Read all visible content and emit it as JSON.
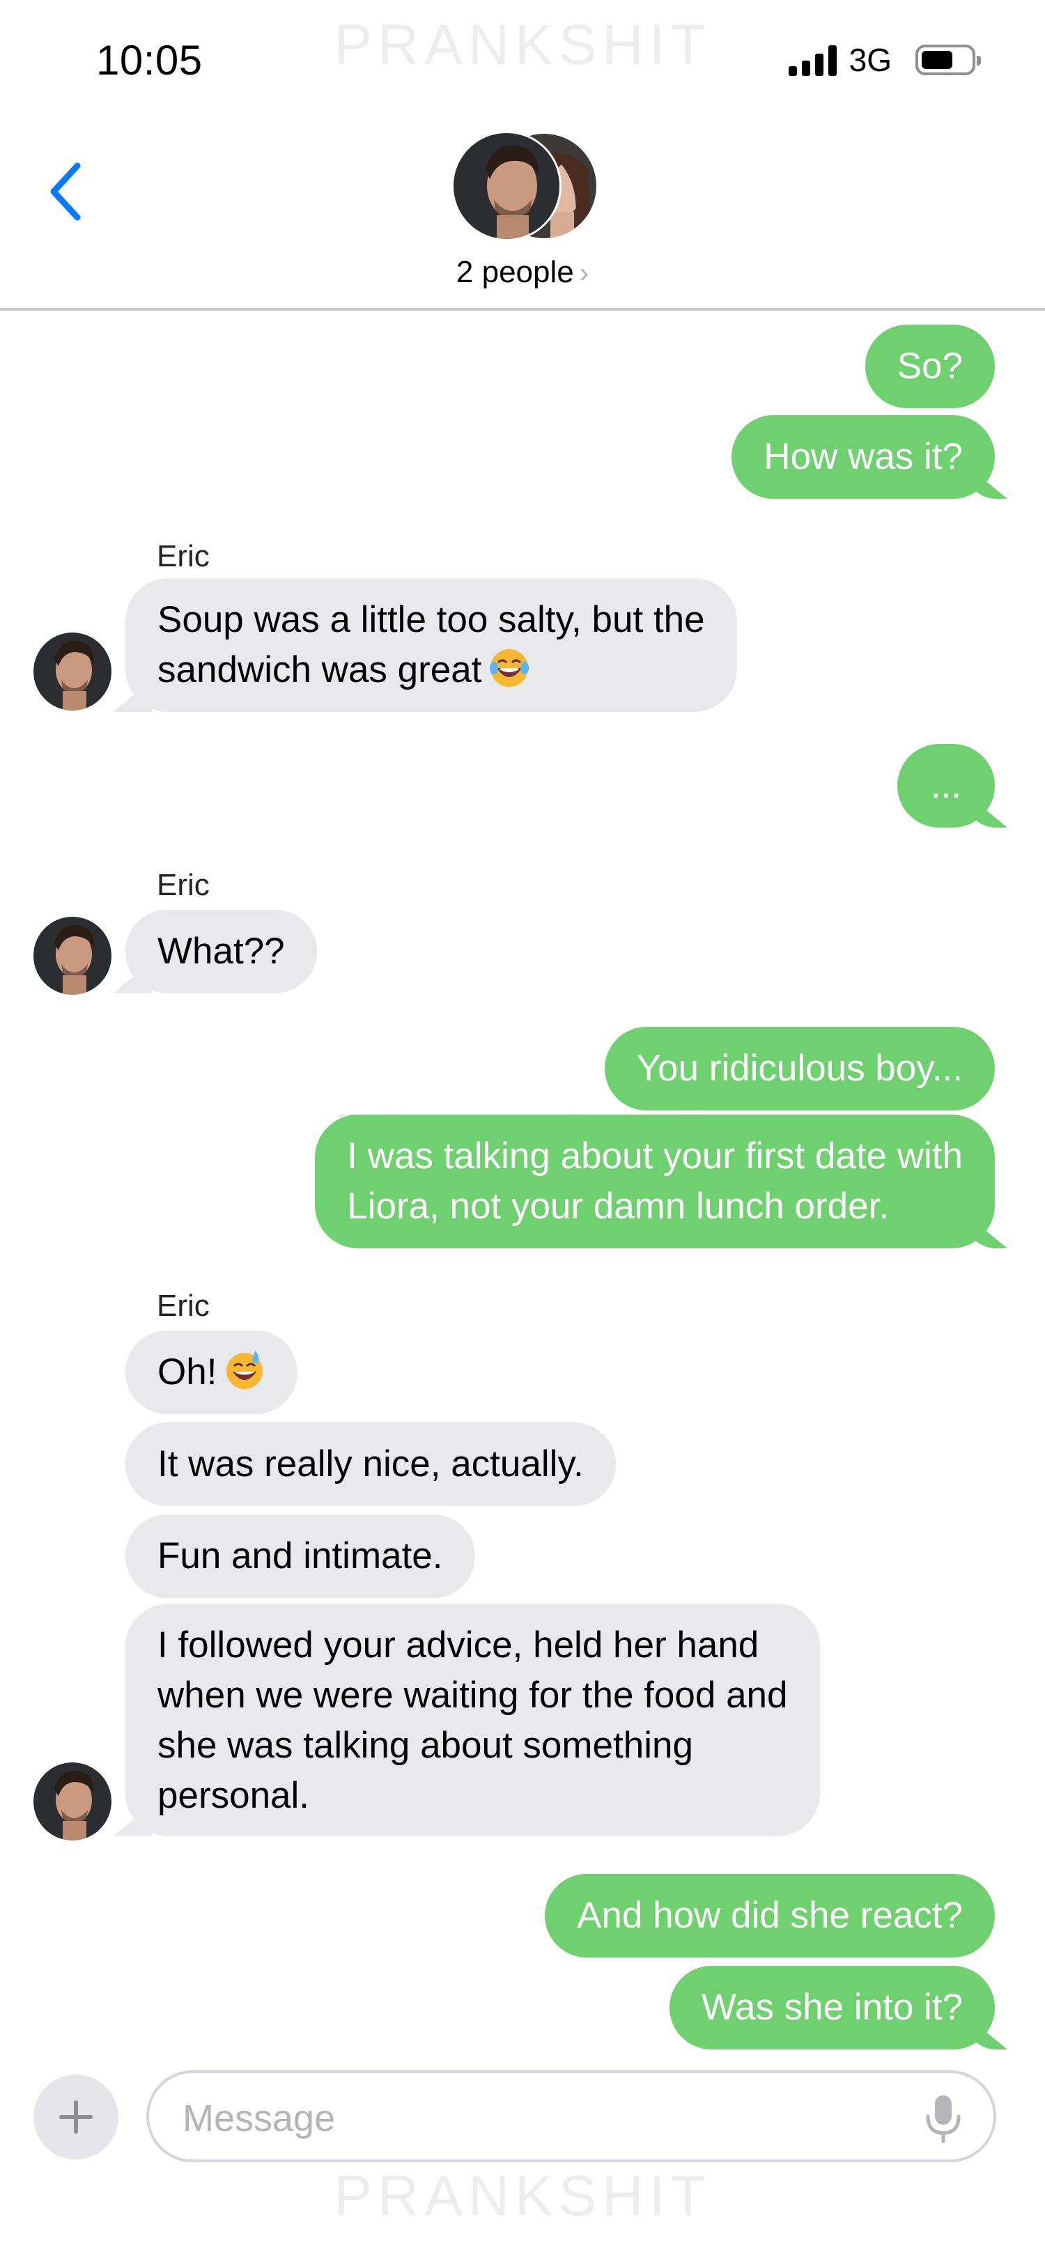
{
  "status_bar": {
    "time": "10:05",
    "network": "3G"
  },
  "watermark": "PRANKSHIT",
  "header": {
    "back_icon": "chevron-left-icon",
    "group_label": "2 people",
    "chevron": "›"
  },
  "messages": [
    {
      "dir": "out",
      "text": "So?"
    },
    {
      "dir": "out",
      "text": "How was it?"
    },
    {
      "dir": "in",
      "sender": "Eric",
      "lines": [
        "Soup was a little too salty, but the",
        "sandwich was great"
      ],
      "emoji": "laughing-tears-emoji"
    },
    {
      "dir": "out",
      "text": "..."
    },
    {
      "dir": "in",
      "sender": "Eric",
      "text": "What??"
    },
    {
      "dir": "out",
      "text": "You ridiculous boy..."
    },
    {
      "dir": "out",
      "lines": [
        "I was talking about your first date with",
        "Liora, not your damn lunch order."
      ]
    },
    {
      "dir": "in",
      "sender": "Eric",
      "text": "Oh!",
      "emoji": "sweat-smile-emoji"
    },
    {
      "dir": "in",
      "text": "It was really nice, actually."
    },
    {
      "dir": "in",
      "text": "Fun and intimate."
    },
    {
      "dir": "in",
      "lines": [
        "I followed your advice, held her hand",
        "when we were waiting for the food and",
        "she was talking about something",
        "personal."
      ]
    },
    {
      "dir": "out",
      "text": "And how did she react?"
    },
    {
      "dir": "out",
      "text": "Was she into it?"
    }
  ],
  "composer": {
    "placeholder": "Message",
    "add_icon": "plus-icon",
    "mic_icon": "microphone-icon"
  },
  "colors": {
    "outgoing_bubble": "#6ed06e",
    "incoming_bubble": "#e9e9eb",
    "accent": "#0a7aff"
  }
}
